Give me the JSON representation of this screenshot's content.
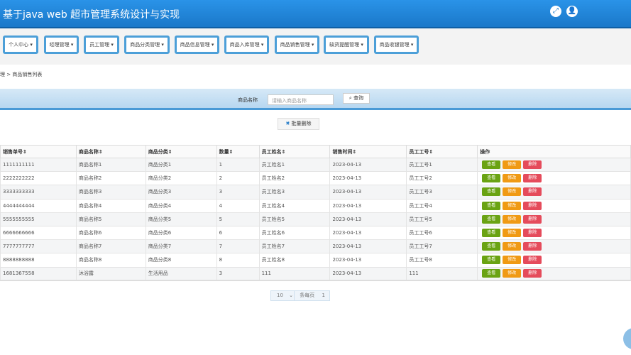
{
  "header": {
    "title": "基于java web 超市管理系统设计与实现",
    "icons": [
      "expand-icon",
      "user-icon"
    ]
  },
  "nav": [
    "个人中心",
    "经理管理",
    "员工管理",
    "商品分类管理",
    "商品信息管理",
    "商品入库管理",
    "商品销售管理",
    "缺货提醒管理",
    "商品收银管理"
  ],
  "breadcrumb": "理 > 商品销售列表",
  "search": {
    "label": "商品名称",
    "placeholder": "请输入商品名称",
    "button": "查询"
  },
  "batch_delete": "批量删除",
  "table": {
    "headers": [
      "销售单号",
      "商品名称",
      "商品分类",
      "数量",
      "员工姓名",
      "销售时间",
      "员工工号",
      "操作"
    ],
    "rows": [
      [
        "1111111111",
        "商品名称1",
        "商品分类1",
        "1",
        "员工姓名1",
        "2023-04-13",
        "员工工号1"
      ],
      [
        "2222222222",
        "商品名称2",
        "商品分类2",
        "2",
        "员工姓名2",
        "2023-04-13",
        "员工工号2"
      ],
      [
        "3333333333",
        "商品名称3",
        "商品分类3",
        "3",
        "员工姓名3",
        "2023-04-13",
        "员工工号3"
      ],
      [
        "4444444444",
        "商品名称4",
        "商品分类4",
        "4",
        "员工姓名4",
        "2023-04-13",
        "员工工号4"
      ],
      [
        "5555555555",
        "商品名称5",
        "商品分类5",
        "5",
        "员工姓名5",
        "2023-04-13",
        "员工工号5"
      ],
      [
        "6666666666",
        "商品名称6",
        "商品分类6",
        "6",
        "员工姓名6",
        "2023-04-13",
        "员工工号6"
      ],
      [
        "7777777777",
        "商品名称7",
        "商品分类7",
        "7",
        "员工姓名7",
        "2023-04-13",
        "员工工号7"
      ],
      [
        "8888888888",
        "商品名称8",
        "商品分类8",
        "8",
        "员工姓名8",
        "2023-04-13",
        "员工工号8"
      ],
      [
        "1681367558",
        "沐浴露",
        "生活用品",
        "3",
        "111",
        "2023-04-13",
        "111"
      ]
    ],
    "actions": [
      "查看",
      "修改",
      "删除"
    ]
  },
  "pagination": {
    "page_size": "10",
    "per_page_label": "条每页",
    "page": "1"
  },
  "colors": {
    "header": "#1a78c9",
    "view": "#6aa313",
    "edit": "#f09a14",
    "delete": "#e54b5b"
  }
}
